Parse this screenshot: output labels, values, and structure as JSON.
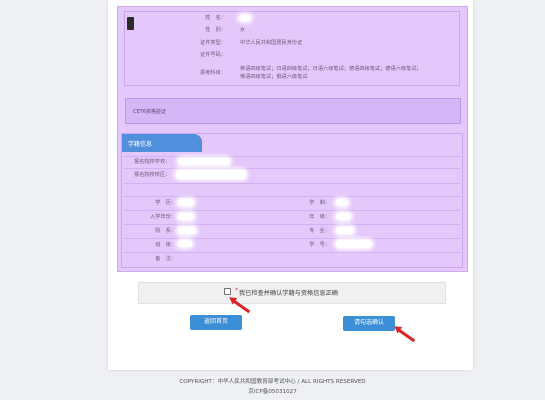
{
  "info": {
    "name_label": "姓　名：",
    "gender_label": "性　别：",
    "gender_value": "女",
    "id_type_label": "证件类型：",
    "id_type_value": "中华人民共和国居民身份证",
    "id_number_label": "证件号码：",
    "exam_subject_label": "报考科目：",
    "exam_subject_line1": "英语四级笔试；日语四级笔试；日语六级笔试；德语四级笔试；德语六级笔试；",
    "exam_subject_line2": "俄语四级笔试；俄语六级笔试"
  },
  "cet": {
    "title": "CET6资格验证"
  },
  "study": {
    "tab_label": "学籍信息",
    "school_label": "报名院校学校：",
    "campus_label": "报名院校校区：",
    "left_labels": [
      "学　历：",
      "入学年份：",
      "院　系：",
      "班　级：",
      "备　注："
    ],
    "right_labels": [
      "学　制：",
      "年　级：",
      "专　业：",
      "学　号："
    ]
  },
  "confirm": {
    "required_mark": "*",
    "text": "我已检查并确认学籍与资格信息正确"
  },
  "buttons": {
    "back_label": "返回首页",
    "confirm_label": "请勾选确认"
  },
  "footer": {
    "copyright": "COPYRIGHT：中华人民共和国教育部考试中心 / ALL RIGHTS RESERVED",
    "icp": "京ICP备05031027"
  },
  "colors": {
    "overlay": "#e4c8fb",
    "button": "#3c8fd6",
    "arrow": "#d8262b",
    "tab": "#4f8fdc"
  }
}
